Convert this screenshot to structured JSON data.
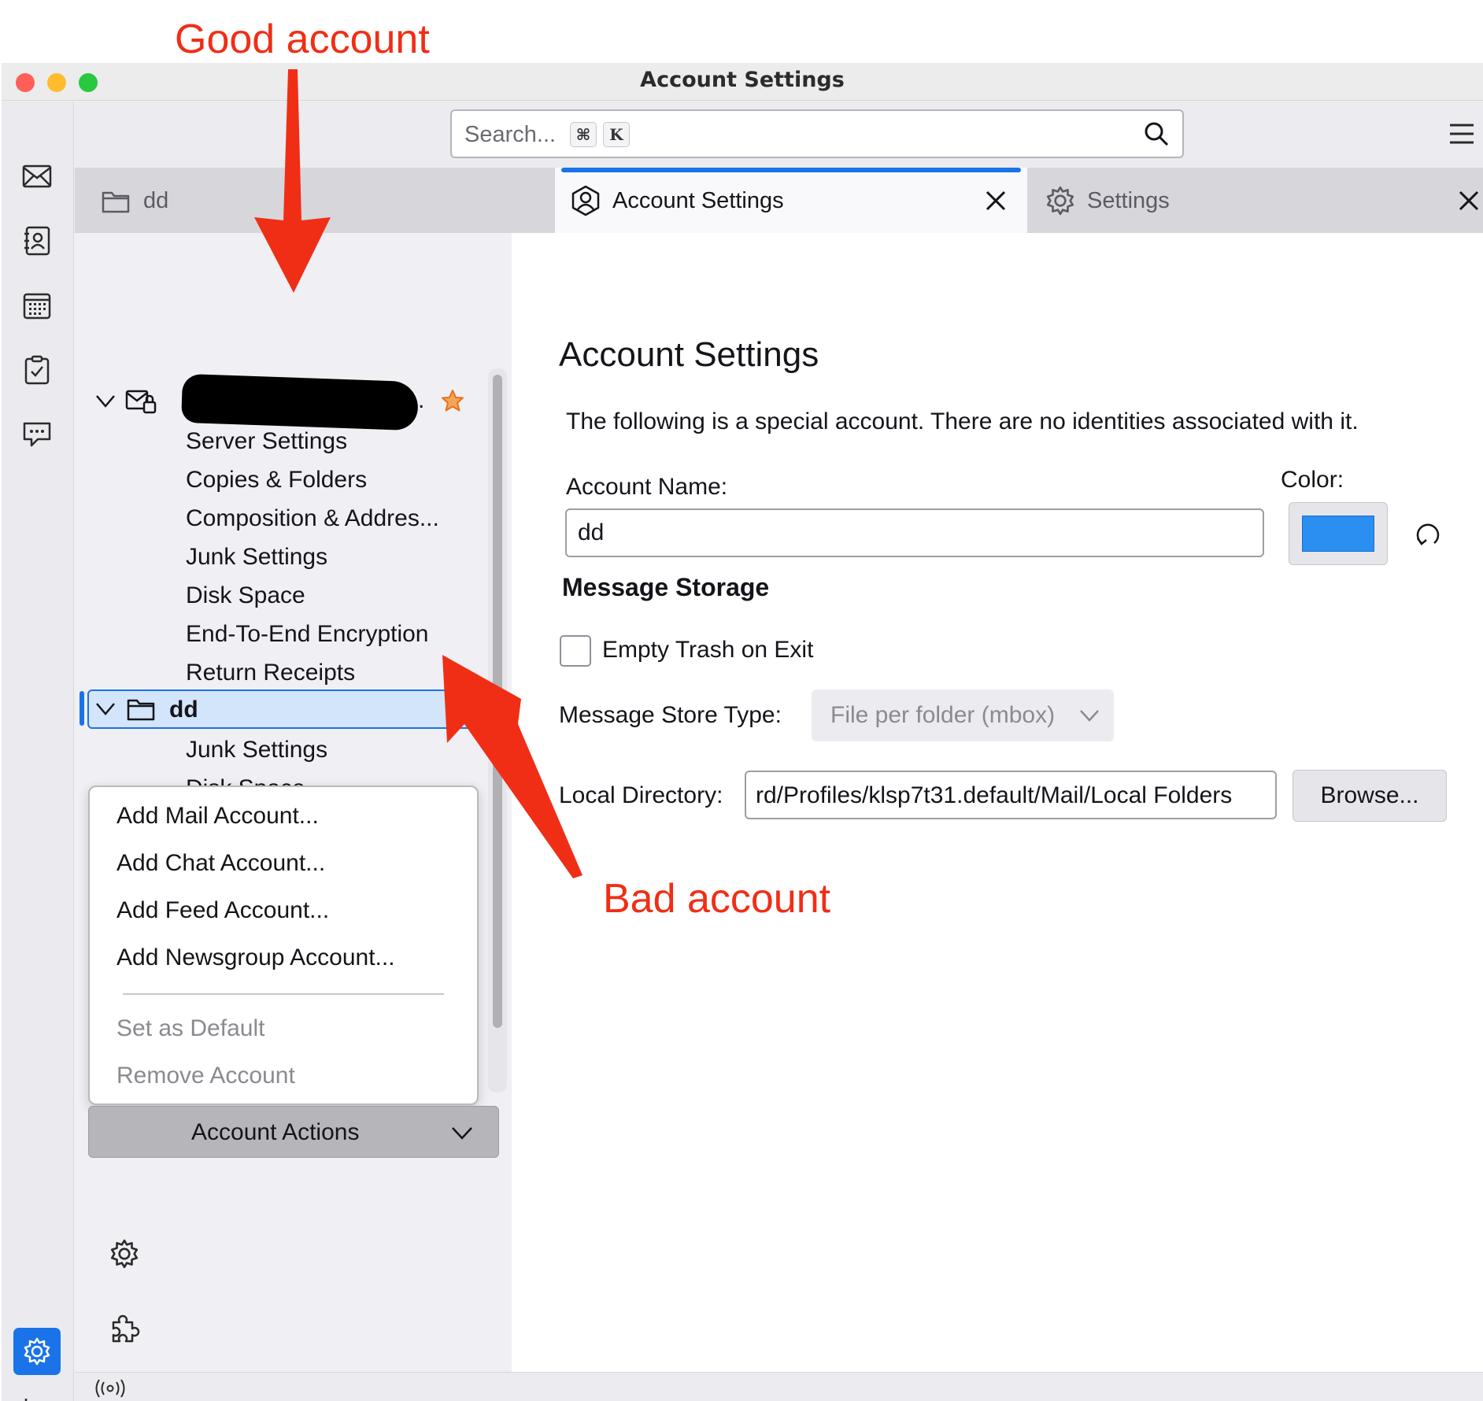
{
  "annotations": {
    "good": "Good account",
    "bad": "Bad account"
  },
  "window": {
    "title": "Account Settings",
    "traffic_colors": [
      "#ff5f57",
      "#febc2e",
      "#28c840"
    ]
  },
  "spaces": [
    "mail-icon",
    "address-book-icon",
    "calendar-icon",
    "tasks-icon",
    "chat-icon"
  ],
  "search": {
    "placeholder": "Search...",
    "shortcut_mod": "⌘",
    "shortcut_key": "K"
  },
  "tabs": [
    {
      "label": "dd"
    },
    {
      "label": "Account Settings"
    },
    {
      "label": "Settings"
    }
  ],
  "tree": {
    "account1_suffix": ".",
    "account1_children": [
      "Server Settings",
      "Copies & Folders",
      "Composition & Addres...",
      "Junk Settings",
      "Disk Space",
      "End-To-End Encryption",
      "Return Receipts"
    ],
    "account2_label": "dd",
    "account2_children": [
      "Junk Settings",
      "Disk Space"
    ]
  },
  "menu": {
    "items": [
      "Add Mail Account...",
      "Add Chat Account...",
      "Add Feed Account...",
      "Add Newsgroup Account..."
    ],
    "disabled_items": [
      "Set as Default",
      "Remove Account"
    ]
  },
  "account_actions_label": "Account Actions",
  "panel": {
    "heading": "Account Settings",
    "description": "The following is a special account. There are no identities associated with it.",
    "account_name_label": "Account Name:",
    "account_name_value": "dd",
    "color_label": "Color:",
    "color_value": "#2a8ff0",
    "storage_heading": "Message Storage",
    "empty_trash_label": "Empty Trash on Exit",
    "store_type_label": "Message Store Type:",
    "store_type_value": "File per folder (mbox)",
    "local_dir_label": "Local Directory:",
    "local_dir_value": "rd/Profiles/klsp7t31.default/Mail/Local Folders",
    "browse_label": "Browse..."
  }
}
